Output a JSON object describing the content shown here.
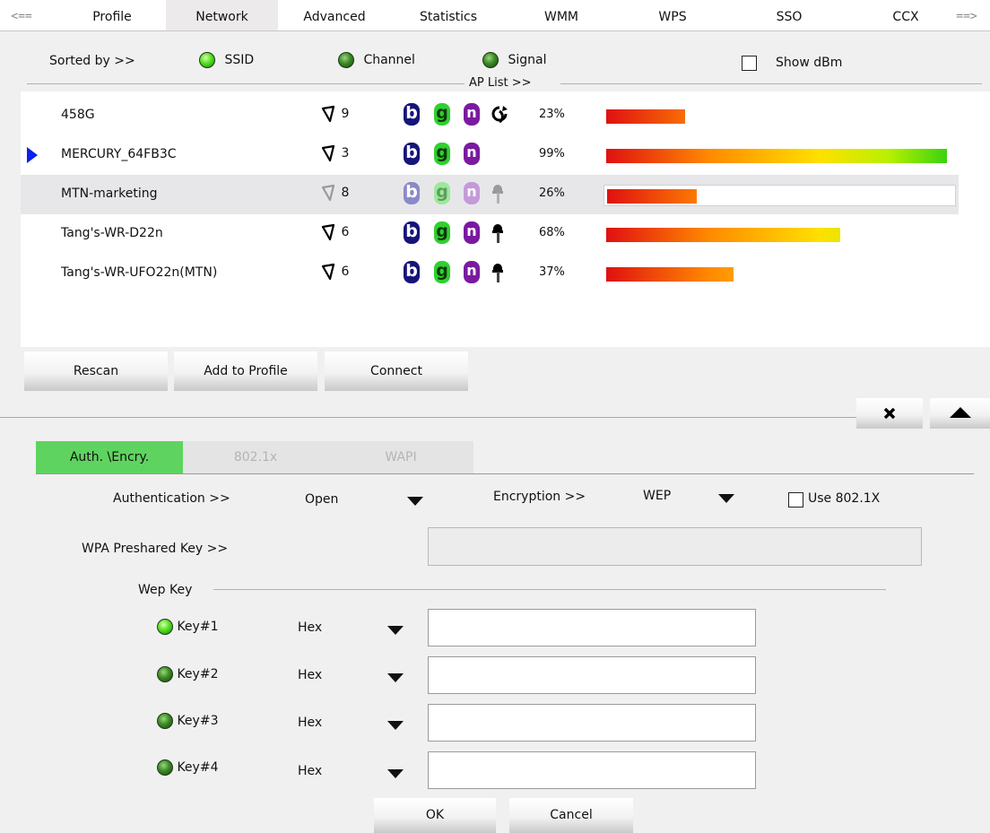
{
  "tabs": [
    {
      "label": "<==",
      "active": false
    },
    {
      "label": "Profile",
      "active": false
    },
    {
      "label": "Network",
      "active": true
    },
    {
      "label": "Advanced",
      "active": false
    },
    {
      "label": "Statistics",
      "active": false
    },
    {
      "label": "WMM",
      "active": false
    },
    {
      "label": "WPS",
      "active": false
    },
    {
      "label": "SSO",
      "active": false
    },
    {
      "label": "CCX",
      "active": false
    },
    {
      "label": "==>",
      "active": false
    }
  ],
  "sort": {
    "label": "Sorted by >>",
    "options": [
      {
        "label": "SSID",
        "selected": true
      },
      {
        "label": "Channel",
        "selected": false
      },
      {
        "label": "Signal",
        "selected": false
      }
    ],
    "show_dbm_label": "Show dBm",
    "show_dbm_checked": false
  },
  "ap_list": {
    "label": "AP List >>",
    "networks": [
      {
        "ssid": "458G",
        "channel": "9",
        "modes": [
          "b",
          "g",
          "n"
        ],
        "extra_icon": "wps-icon",
        "signal": "23%",
        "signal_value": 0.23,
        "connected": false,
        "highlighted": false
      },
      {
        "ssid": "MERCURY_64FB3C",
        "channel": "3",
        "modes": [
          "b",
          "g",
          "n"
        ],
        "extra_icon": "none",
        "signal": "99%",
        "signal_value": 0.99,
        "connected": true,
        "highlighted": false
      },
      {
        "ssid": "MTN-marketing",
        "channel": "8",
        "modes": [
          "b",
          "g",
          "n"
        ],
        "extra_icon": "lock-icon",
        "signal": "26%",
        "signal_value": 0.26,
        "connected": false,
        "highlighted": true
      },
      {
        "ssid": "Tang's-WR-D22n",
        "channel": "6",
        "modes": [
          "b",
          "g",
          "n"
        ],
        "extra_icon": "lock-icon",
        "signal": "68%",
        "signal_value": 0.68,
        "connected": false,
        "highlighted": false
      },
      {
        "ssid": "Tang's-WR-UFO22n(MTN)",
        "channel": "6",
        "modes": [
          "b",
          "g",
          "n"
        ],
        "extra_icon": "lock-icon",
        "signal": "37%",
        "signal_value": 0.37,
        "connected": false,
        "highlighted": false
      }
    ]
  },
  "actions": {
    "rescan": "Rescan",
    "add_to_profile": "Add to Profile",
    "connect": "Connect"
  },
  "subtabs": [
    {
      "label": "Auth. \\Encry.",
      "active": true
    },
    {
      "label": "802.1x",
      "active": false
    },
    {
      "label": "WAPI",
      "active": false
    }
  ],
  "security": {
    "auth_label": "Authentication >>",
    "auth_value": "Open",
    "encryption_label": "Encryption >>",
    "encryption_value": "WEP",
    "use8021x_label": "Use 802.1X",
    "use8021x_checked": false,
    "wpa_psk_label": "WPA Preshared Key >>",
    "wpa_psk_value": "",
    "wep_key_label": "Wep Key",
    "keys": [
      {
        "label": "Key#1",
        "format": "Hex",
        "value": "",
        "selected": true
      },
      {
        "label": "Key#2",
        "format": "Hex",
        "value": "",
        "selected": false
      },
      {
        "label": "Key#3",
        "format": "Hex",
        "value": "",
        "selected": false
      },
      {
        "label": "Key#4",
        "format": "Hex",
        "value": "",
        "selected": false
      }
    ]
  },
  "dialog": {
    "ok": "OK",
    "cancel": "Cancel"
  },
  "colors": {
    "active_tab_green": "#5fd35f",
    "connected_marker": "#0a1ff0",
    "selected_row": "#e7e7ea"
  }
}
